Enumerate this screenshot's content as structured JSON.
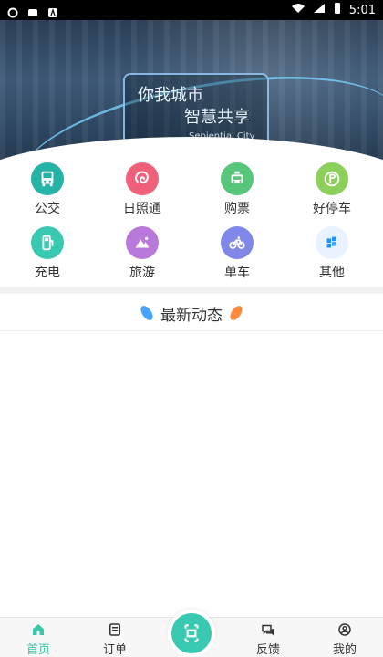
{
  "status": {
    "time": "5:01"
  },
  "banner": {
    "line1": "你我城市",
    "line2": "智慧共享",
    "sub": "Sepiential City"
  },
  "services": [
    {
      "label": "公交",
      "icon": "bus-icon",
      "color": "#25b3a5"
    },
    {
      "label": "日照通",
      "icon": "rizhao-tong-icon",
      "color": "#f0607b"
    },
    {
      "label": "购票",
      "icon": "taxi-icon",
      "color": "#57c57a"
    },
    {
      "label": "好停车",
      "icon": "parking-icon",
      "color": "#8ccf5a"
    },
    {
      "label": "充电",
      "icon": "charging-icon",
      "color": "#39c9b0"
    },
    {
      "label": "旅游",
      "icon": "travel-mountain-icon",
      "color": "#b879db"
    },
    {
      "label": "单车",
      "icon": "bike-icon",
      "color": "#7f87e8"
    },
    {
      "label": "其他",
      "icon": "grid-icon",
      "color": "#e9f3ff"
    }
  ],
  "news": {
    "title": "最新动态"
  },
  "nav": {
    "items": [
      {
        "label": "首页",
        "icon": "home-icon",
        "active": true
      },
      {
        "label": "订单",
        "icon": "orders-icon",
        "active": false
      },
      {
        "label": "反馈",
        "icon": "feedback-icon",
        "active": false
      },
      {
        "label": "我的",
        "icon": "profile-icon",
        "active": false
      }
    ],
    "center": {
      "icon": "scan-icon"
    }
  },
  "colors": {
    "accent": "#39c9b0"
  }
}
